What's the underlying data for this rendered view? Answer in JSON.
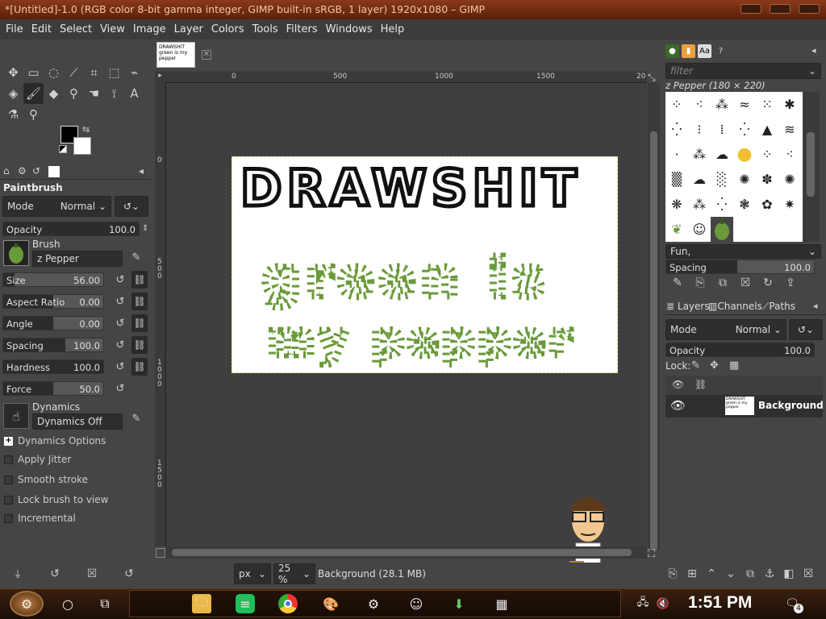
{
  "window": {
    "title": "*[Untitled]-1.0 (RGB color 8-bit gamma integer, GIMP built-in sRGB, 1 layer) 1920x1080 – GIMP"
  },
  "menu": [
    "File",
    "Edit",
    "Select",
    "View",
    "Image",
    "Layer",
    "Colors",
    "Tools",
    "Filters",
    "Windows",
    "Help"
  ],
  "tool_options": {
    "title": "Paintbrush",
    "mode_label": "Mode",
    "mode_value": "Normal",
    "opacity": {
      "label": "Opacity",
      "value": "100.0",
      "fraction": 1.0
    },
    "brush_label": "Brush",
    "brush_value": "z Pepper",
    "sliders": [
      {
        "label": "Size",
        "value": "56.00",
        "fraction": 0.11
      },
      {
        "label": "Aspect Ratio",
        "value": "0.00",
        "fraction": 0.5
      },
      {
        "label": "Angle",
        "value": "0.00",
        "fraction": 0.5
      },
      {
        "label": "Spacing",
        "value": "100.0",
        "fraction": 0.62
      },
      {
        "label": "Hardness",
        "value": "100.0",
        "fraction": 1.0
      },
      {
        "label": "Force",
        "value": "50.0",
        "fraction": 0.5
      }
    ],
    "dynamics_label": "Dynamics",
    "dynamics_value": "Dynamics Off",
    "dynamics_options": "Dynamics Options",
    "checkboxes": [
      "Apply Jitter",
      "Smooth stroke",
      "Lock brush to view",
      "Incremental"
    ]
  },
  "image_tab_text": "DRAWSHIT green is my pepper",
  "canvas_text": {
    "line1": "DRAWSHIT",
    "line2": "green is",
    "line3": "my pepper"
  },
  "rulers": {
    "h": [
      "0",
      "500",
      "1000",
      "1500",
      "20"
    ],
    "v": [
      "0",
      "5 0 0",
      "1 0 0 0",
      "1 5 0 0"
    ]
  },
  "statusbar": {
    "unit": "px",
    "zoom": "25 %",
    "info": "Background (28.1 MB)"
  },
  "brushes": {
    "filter_placeholder": "filter",
    "selected_label": "z Pepper (180 × 220)",
    "tag": "Fun,",
    "spacing_label": "Spacing",
    "spacing_value": "100.0"
  },
  "layers": {
    "tabs": [
      "Layers",
      "Channels",
      "Paths"
    ],
    "mode_label": "Mode",
    "mode_value": "Normal",
    "opacity_label": "Opacity",
    "opacity_value": "100.0",
    "lock_label": "Lock:",
    "layer_name": "Background"
  },
  "taskbar": {
    "time": "1:51 PM",
    "notif_count": "4"
  },
  "colors": {
    "fg": "#000000",
    "bg": "#ffffff",
    "pepper": "#6a9a3a"
  }
}
